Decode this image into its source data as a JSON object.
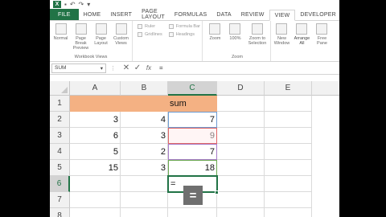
{
  "quick_access": {
    "undo": "↶",
    "redo": "↷",
    "dropdown": "▾"
  },
  "tabs": [
    "FILE",
    "HOME",
    "INSERT",
    "PAGE LAYOUT",
    "FORMULAS",
    "DATA",
    "REVIEW",
    "VIEW",
    "DEVELOPER"
  ],
  "active_tab": "VIEW",
  "ribbon": {
    "workbook_views": {
      "label": "Workbook Views",
      "buttons": [
        "Normal",
        "Page Break Preview",
        "Page Layout",
        "Custom Views"
      ]
    },
    "show": {
      "items": [
        "Ruler",
        "Formula Bar",
        "Gridlines",
        "Headings"
      ]
    },
    "zoom": {
      "label": "Zoom",
      "buttons": [
        "Zoom",
        "100%",
        "Zoom to Selection"
      ]
    },
    "window": {
      "buttons": [
        "New Window",
        "Arrange All",
        "Free Pane"
      ]
    }
  },
  "formula_bar": {
    "name_box": "SUM",
    "cancel": "✕",
    "enter": "✓",
    "fx": "fx",
    "formula": "="
  },
  "columns": [
    "A",
    "B",
    "C",
    "D",
    "E"
  ],
  "selected_column": "C",
  "rows": [
    "1",
    "2",
    "3",
    "4",
    "5",
    "6",
    "7",
    "8"
  ],
  "selected_row": "6",
  "cells": {
    "C1": "sum",
    "A2": "3",
    "B2": "4",
    "C2": "7",
    "A3": "6",
    "B3": "3",
    "C3": "9",
    "A4": "5",
    "B4": "2",
    "C4": "7",
    "A5": "15",
    "B5": "3",
    "C5": "18"
  },
  "active_cell": {
    "ref": "C6",
    "value": "="
  },
  "quick_button": "=",
  "colors": {
    "header_fill": "#f4b183",
    "excel_green": "#217346"
  }
}
